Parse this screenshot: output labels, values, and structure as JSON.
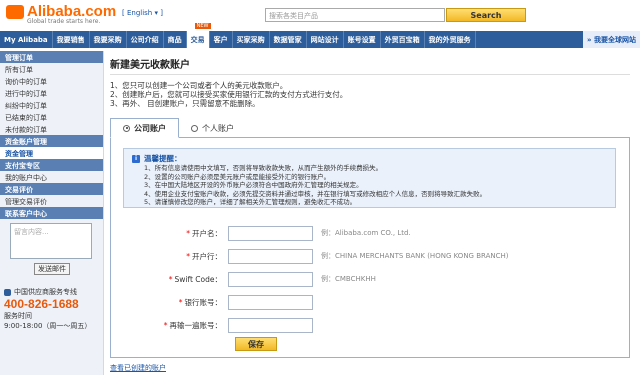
{
  "header": {
    "logo_text": "Alibaba.com",
    "tagline": "Global trade starts here.",
    "language": "[ English ▾ ]",
    "search_placeholder": "搜索各类目产品",
    "search_button": "Search"
  },
  "nav": {
    "items": [
      "My Alibaba",
      "我要销售",
      "我要采购",
      "公司介绍",
      "商品",
      "交易",
      "客户",
      "买家采购",
      "数据管家",
      "网站设计",
      "账号设置",
      "外贸百宝箱",
      "我的外贸服务"
    ],
    "active_index": 5,
    "new_badge": "NEW",
    "end_link": "» 我要全球网站"
  },
  "sidebar": {
    "sections": [
      {
        "title": "管理订单",
        "items": [
          "所有订单",
          "询价中的订单",
          "进行中的订单",
          "纠纷中的订单",
          "已结束的订单",
          "未付款的订单"
        ]
      },
      {
        "title": "资金账户管理",
        "items": [
          "资金管理"
        ],
        "active": 0
      },
      {
        "title": "支付宝专区",
        "items": [
          "我的账户中心"
        ]
      },
      {
        "title": "交易评价",
        "items": [
          "管理交易评价"
        ]
      }
    ],
    "message_title": "联系客户中心",
    "message_placeholder": "留言内容...",
    "send_button": "发送邮件",
    "hotline_label": "中国供应商服务专线",
    "hotline_number": "400-826-1688",
    "hours_label": "服务时间",
    "hours": "9:00-18:00（周一～周五）"
  },
  "main": {
    "title": "新建美元收款账户",
    "notes": [
      "1、您只可以创建一个公司或者个人的美元收款账户。",
      "2、创建账户后，您就可以接受买家使用银行汇款的支付方式进行支付。",
      "3、再外、        目创建账户，只需留意不能删除。"
    ],
    "tabs": [
      {
        "label": "公司账户",
        "selected": true
      },
      {
        "label": "个人账户",
        "selected": false
      }
    ],
    "tips_title": "温馨提醒：",
    "tips": [
      "1、所有信息请使用中文填写，否则将导致收款失败，从而产生额外的手续费损失。",
      "2、设置的公司账户必须是美元账户或是能接受外汇的银行账户。",
      "3、在中国大陆地区开设的外币账户必须符合中国政府外汇管理的相关规定。",
      "4、使用企业支付宝账户收款，必须先提交资料并通过审核，并在银行填写或修改相应个人信息，否则将导致汇款失败。",
      "5、请谨慎修改您的账户，详细了解相关外汇管理规则，避免收汇不成功。"
    ],
    "form": [
      {
        "label": "开户名：",
        "hint": "例：Alibaba.com CO., Ltd."
      },
      {
        "label": "开户行：",
        "hint": "例：CHINA MERCHANTS BANK (HONG KONG BRANCH)"
      },
      {
        "label": "Swift Code：",
        "hint": "例：CMBCHKHH"
      },
      {
        "label": "银行账号：",
        "hint": ""
      },
      {
        "label": "再输一遍账号：",
        "hint": ""
      }
    ],
    "save_button": "保存",
    "view_link": "查看已创建的账户"
  }
}
